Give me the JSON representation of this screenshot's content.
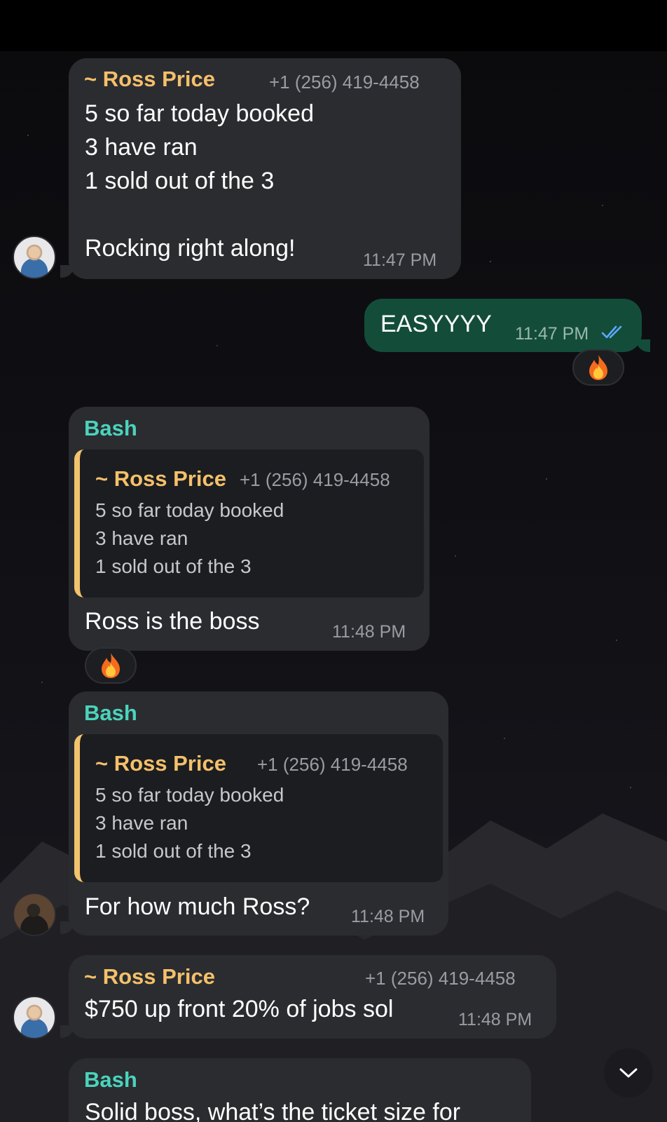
{
  "messages": [
    {
      "sender": "~ Ross Price",
      "phone": "+1 (256) 419-4458",
      "text": "5 so far today booked\n3 have ran\n1 sold out of the 3\n\nRocking right along!",
      "time": "11:47 PM"
    },
    {
      "text": "EASYYYY",
      "time": "11:47 PM",
      "read": "double-check-icon",
      "reaction": "🔥"
    },
    {
      "sender": "Bash",
      "quote": {
        "sender": "~ Ross Price",
        "phone": "+1 (256) 419-4458",
        "text": "5 so far today booked\n3 have ran\n1 sold out of the 3"
      },
      "text": "Ross is the boss",
      "time": "11:48 PM",
      "reaction": "🔥"
    },
    {
      "sender": "Bash",
      "quote": {
        "sender": "~ Ross Price",
        "phone": "+1 (256) 419-4458",
        "text": "5 so far today booked\n3 have ran\n1 sold out of the 3"
      },
      "text": "For how much Ross?",
      "time": "11:48 PM"
    },
    {
      "sender": "~ Ross Price",
      "phone": "+1 (256) 419-4458",
      "text": "$750 up front 20% of jobs sol",
      "time": "11:48 PM"
    },
    {
      "sender": "Bash",
      "text": "Solid boss, what’s the ticket size for"
    }
  ],
  "scroll_button_icon": "chevron-down-icon",
  "colors": {
    "incoming_bubble": "#2b2c30",
    "outgoing_bubble": "#134d3a",
    "ross_name": "#f4c06a",
    "bash_name": "#4ad4bc",
    "quote_bar": "#f2c46d"
  }
}
